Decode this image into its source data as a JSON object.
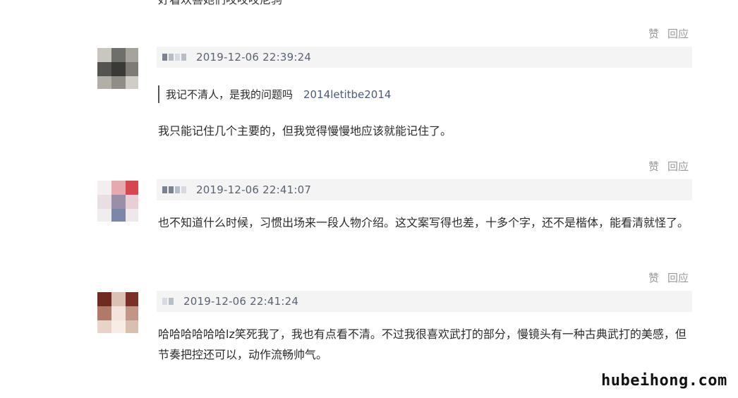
{
  "previous_comment_tail": "好看欢喜她们哎哎哎尼驹",
  "actions": {
    "like_label": "赞",
    "reply_label": "回应"
  },
  "comments": [
    {
      "timestamp": "2019-12-06 22:39:24",
      "quote": {
        "text": "我记不清人，是我的问题吗",
        "user": "2014letitbe2014"
      },
      "content": "我只能记住几个主要的，但我觉得慢慢地应该就能记住了。"
    },
    {
      "timestamp": "2019-12-06 22:41:07",
      "content": "也不知道什么时候，习惯出场来一段人物介绍。这文案写得也差，十多个字，还不是楷体，能看清就怪了。"
    },
    {
      "timestamp": "2019-12-06 22:41:24",
      "content": "哈哈哈哈哈哈lz笑死我了，我也有点看不清。不过我很喜欢武打的部分，慢镜头有一种古典武打的美感，但节奏把控还可以，动作流畅帅气。"
    }
  ],
  "watermark": "hubeihong.com",
  "colors": {
    "meta_bar_bg": "#f4f4f4",
    "timestamp": "#5a6375",
    "action_text": "#9a9a9a"
  }
}
